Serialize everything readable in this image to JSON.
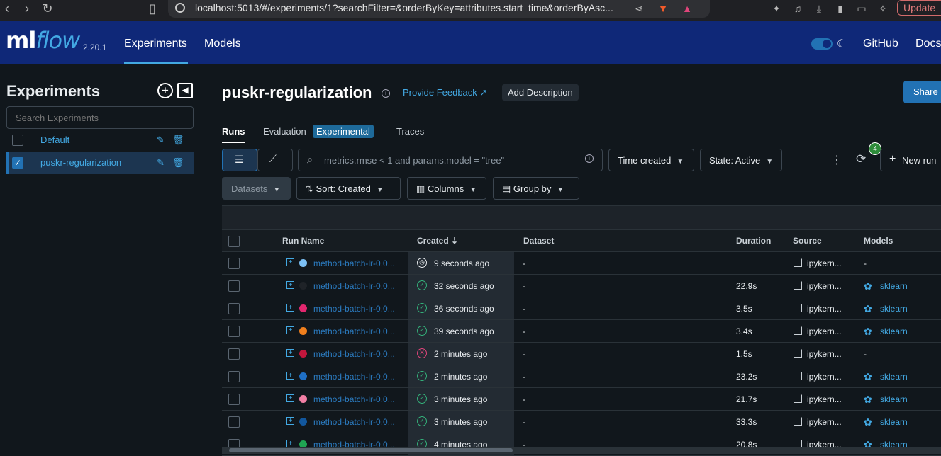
{
  "browser": {
    "url": "localhost:5013/#/experiments/1?searchFilter=&orderByKey=attributes.start_time&orderByAsc...",
    "update_label": "Update"
  },
  "header": {
    "logo_ml": "ml",
    "logo_flow": "flow",
    "version": "2.20.1",
    "nav": [
      "Experiments",
      "Models"
    ],
    "github": "GitHub",
    "docs": "Docs"
  },
  "sidebar": {
    "title": "Experiments",
    "search_placeholder": "Search Experiments",
    "experiments": [
      {
        "name": "Default",
        "checked": false
      },
      {
        "name": "puskr-regularization",
        "checked": true
      }
    ]
  },
  "main": {
    "title": "puskr-regularization",
    "feedback": "Provide Feedback",
    "add_description": "Add Description",
    "share": "Share",
    "tabs": [
      "Runs",
      "Evaluation",
      "Traces"
    ],
    "experimental_badge": "Experimental",
    "search_placeholder": "metrics.rmse < 1 and params.model = \"tree\"",
    "time_created": "Time created",
    "state": "State: Active",
    "refresh_badge": "4",
    "new_run": "New run",
    "datasets": "Datasets",
    "sort": "Sort: Created",
    "columns": "Columns",
    "group_by": "Group by"
  },
  "table": {
    "headers": [
      "Run Name",
      "Created",
      "Dataset",
      "Duration",
      "Source",
      "Models"
    ],
    "rows": [
      {
        "color": "#7cc0f5",
        "name": "method-batch-lr-0.0...",
        "status": "running",
        "created": "9 seconds ago",
        "dataset": "-",
        "duration": "",
        "source": "ipykern...",
        "model": "-"
      },
      {
        "color": "#1f2328",
        "name": "method-batch-lr-0.0...",
        "status": "ok",
        "created": "32 seconds ago",
        "dataset": "-",
        "duration": "22.9s",
        "source": "ipykern...",
        "model": "sklearn"
      },
      {
        "color": "#e3276f",
        "name": "method-batch-lr-0.0...",
        "status": "ok",
        "created": "36 seconds ago",
        "dataset": "-",
        "duration": "3.5s",
        "source": "ipykern...",
        "model": "sklearn"
      },
      {
        "color": "#f07f1d",
        "name": "method-batch-lr-0.0...",
        "status": "ok",
        "created": "39 seconds ago",
        "dataset": "-",
        "duration": "3.4s",
        "source": "ipykern...",
        "model": "sklearn"
      },
      {
        "color": "#c2163c",
        "name": "method-batch-lr-0.0...",
        "status": "fail",
        "created": "2 minutes ago",
        "dataset": "-",
        "duration": "1.5s",
        "source": "ipykern...",
        "model": "-"
      },
      {
        "color": "#1f6fc5",
        "name": "method-batch-lr-0.0...",
        "status": "ok",
        "created": "2 minutes ago",
        "dataset": "-",
        "duration": "23.2s",
        "source": "ipykern...",
        "model": "sklearn"
      },
      {
        "color": "#f27fa5",
        "name": "method-batch-lr-0.0...",
        "status": "ok",
        "created": "3 minutes ago",
        "dataset": "-",
        "duration": "21.7s",
        "source": "ipykern...",
        "model": "sklearn"
      },
      {
        "color": "#12579e",
        "name": "method-batch-lr-0.0...",
        "status": "ok",
        "created": "3 minutes ago",
        "dataset": "-",
        "duration": "33.3s",
        "source": "ipykern...",
        "model": "sklearn"
      },
      {
        "color": "#1fa653",
        "name": "method-batch-lr-0.0...",
        "status": "ok",
        "created": "4 minutes ago",
        "dataset": "-",
        "duration": "20.8s",
        "source": "ipykern...",
        "model": "sklearn"
      }
    ]
  }
}
